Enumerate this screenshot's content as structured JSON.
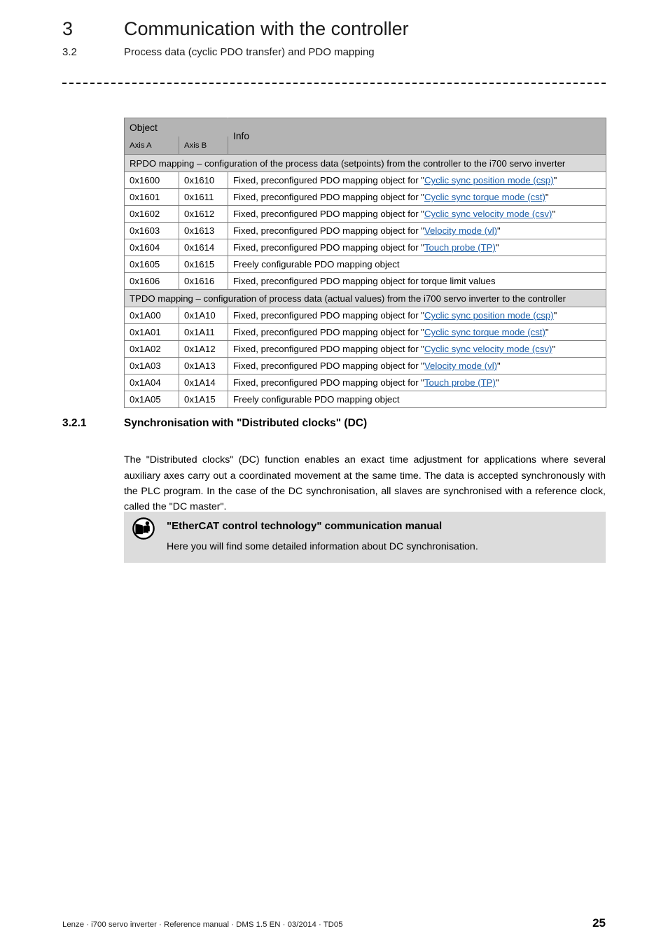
{
  "header": {
    "chapter_number": "3",
    "chapter_title": "Communication with the controller",
    "section_number": "3.2",
    "section_title": "Process data (cyclic PDO transfer) and PDO mapping"
  },
  "table": {
    "columns": {
      "object": "Object",
      "axis_a": "Axis A",
      "axis_b": "Axis B",
      "info": "Info"
    },
    "groups": [
      {
        "caption": "RPDO mapping – configuration of the process data (setpoints) from the controller to the i700 servo inverter",
        "rows": [
          {
            "axis_a": "0x1600",
            "axis_b": "0x1610",
            "prefix": "Fixed, preconfigured PDO mapping object for \"",
            "link": "Cyclic sync position mode (csp)",
            "suffix": "\""
          },
          {
            "axis_a": "0x1601",
            "axis_b": "0x1611",
            "prefix": "Fixed, preconfigured PDO mapping object for \"",
            "link": "Cyclic sync torque mode (cst)",
            "suffix": "\""
          },
          {
            "axis_a": "0x1602",
            "axis_b": "0x1612",
            "prefix": "Fixed, preconfigured PDO mapping object for \"",
            "link": "Cyclic sync velocity mode (csv)",
            "suffix": "\""
          },
          {
            "axis_a": "0x1603",
            "axis_b": "0x1613",
            "prefix": "Fixed, preconfigured PDO mapping object for \"",
            "link": "Velocity mode (vl)",
            "suffix": "\""
          },
          {
            "axis_a": "0x1604",
            "axis_b": "0x1614",
            "prefix": "Fixed, preconfigured PDO mapping object for \"",
            "link": "Touch probe (TP)",
            "suffix": "\""
          },
          {
            "axis_a": "0x1605",
            "axis_b": "0x1615",
            "prefix": "Freely configurable PDO mapping object",
            "link": "",
            "suffix": ""
          },
          {
            "axis_a": "0x1606",
            "axis_b": "0x1616",
            "prefix": "Fixed, preconfigured PDO mapping object for torque limit values",
            "link": "",
            "suffix": ""
          }
        ]
      },
      {
        "caption": "TPDO mapping – configuration of process data (actual values) from the i700 servo inverter to the controller",
        "rows": [
          {
            "axis_a": "0x1A00",
            "axis_b": "0x1A10",
            "prefix": "Fixed, preconfigured PDO mapping object for \"",
            "link": "Cyclic sync position mode (csp)",
            "suffix": "\""
          },
          {
            "axis_a": "0x1A01",
            "axis_b": "0x1A11",
            "prefix": "Fixed, preconfigured PDO mapping object for \"",
            "link": "Cyclic sync torque mode (cst)",
            "suffix": "\""
          },
          {
            "axis_a": "0x1A02",
            "axis_b": "0x1A12",
            "prefix": "Fixed, preconfigured PDO mapping object for \"",
            "link": "Cyclic sync velocity mode (csv)",
            "suffix": "\""
          },
          {
            "axis_a": "0x1A03",
            "axis_b": "0x1A13",
            "prefix": "Fixed, preconfigured PDO mapping object for \"",
            "link": "Velocity mode (vl)",
            "suffix": "\""
          },
          {
            "axis_a": "0x1A04",
            "axis_b": "0x1A14",
            "prefix": "Fixed, preconfigured PDO mapping object for \"",
            "link": "Touch probe (TP)",
            "suffix": "\""
          },
          {
            "axis_a": "0x1A05",
            "axis_b": "0x1A15",
            "prefix": "Freely configurable PDO mapping object",
            "link": "",
            "suffix": ""
          }
        ]
      }
    ]
  },
  "subsection": {
    "number": "3.2.1",
    "title": "Synchronisation with \"Distributed clocks\" (DC)",
    "paragraph": "The \"Distributed clocks\" (DC) function enables an exact time adjustment for applications where several auxiliary axes carry out a coordinated movement at the same time. The data is accepted synchronously with the PLC program. In the case of the DC synchronisation, all slaves are synchronised with a reference clock, called the \"DC master\"."
  },
  "note": {
    "icon": "documentation-reference-icon",
    "title": "\"EtherCAT control technology\" communication manual",
    "text": "Here you will find some detailed information about DC synchronisation."
  },
  "footer": {
    "text": "Lenze · i700 servo inverter · Reference manual · DMS 1.5 EN · 03/2014 · TD05",
    "page_number": "25"
  },
  "colors": {
    "link": "#1a5da8",
    "table_header_bg": "#b4b4b4",
    "table_group_bg": "#dadada",
    "note_bg": "#dcdcdc"
  }
}
